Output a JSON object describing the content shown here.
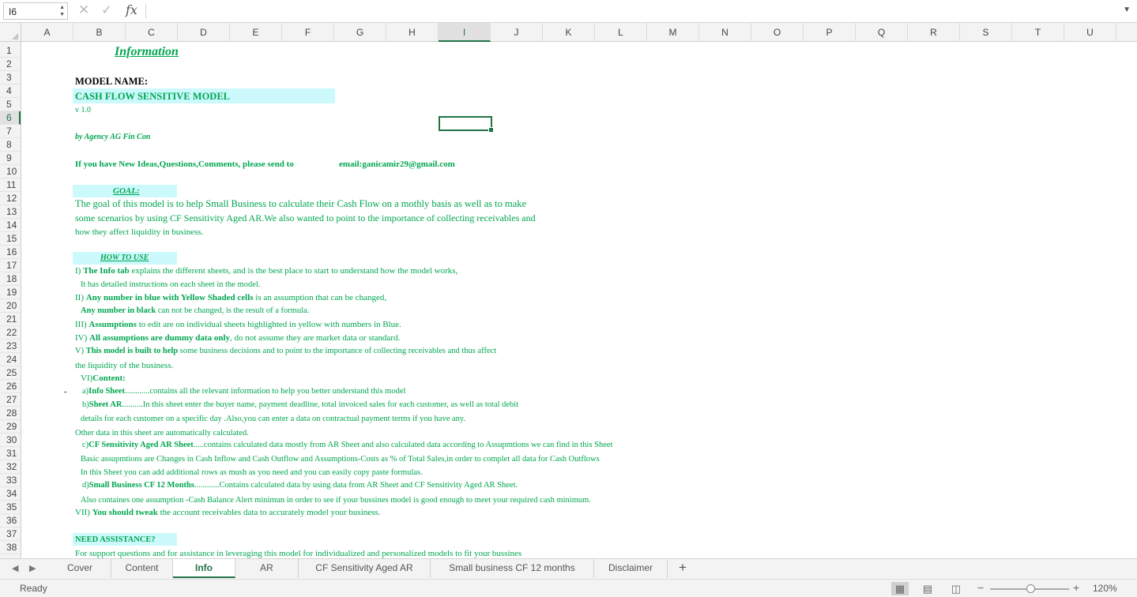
{
  "formula_bar": {
    "name_box": "I6",
    "cancel_icon": "✕",
    "enter_icon": "✓",
    "fx_label": "fx",
    "formula": ""
  },
  "columns": [
    "A",
    "B",
    "C",
    "D",
    "E",
    "F",
    "G",
    "H",
    "I",
    "J",
    "K",
    "L",
    "M",
    "N",
    "O",
    "P",
    "Q",
    "R",
    "S",
    "T",
    "U"
  ],
  "selected_column": "I",
  "rows": [
    "1",
    "2",
    "3",
    "4",
    "5",
    "6",
    "7",
    "8",
    "9",
    "10",
    "11",
    "12",
    "13",
    "14",
    "15",
    "16",
    "17",
    "18",
    "19",
    "20",
    "21",
    "22",
    "23",
    "24",
    "25",
    "26",
    "27",
    "28",
    "29",
    "30",
    "31",
    "32",
    "33",
    "34",
    "35",
    "36",
    "37",
    "38"
  ],
  "selected_row": "6",
  "sheet": {
    "title": "Information",
    "model_name_label": "MODEL NAME:",
    "model_name": "CASH FLOW SENSITIVE MODEL",
    "version": "v 1.0",
    "author": "by Agency AG Fin Con",
    "contact_text": "If you have New Ideas,Questions,Comments, please send to",
    "contact_email": "email:ganicamir29@gmail.com",
    "goal_label": "GOAL:",
    "goal_lines": [
      "The goal of this model is to help Small Business to calculate their Cash Flow on a mothly basis as well as to make",
      "some scenarios by using CF Sensitivity Aged AR.We also wanted to point to the importance of collecting receivables and",
      "how they affect liquidity in business."
    ],
    "how_to_label": "HOW TO USE",
    "l17_a": "I) ",
    "l17_b": "The Info tab",
    "l17_c": " explains the different sheets, and is the best place to start to understand how the model works,",
    "l18": "It has detailed instructions on each sheet in the model.",
    "l19_a": "II) ",
    "l19_b": "Any number in blue with Yellow Shaded cells",
    "l19_c": " is an assumption that can be changed,",
    "l20_b": "Any number in black",
    "l20_c": "  can not be changed,  is the result of a formula.",
    "l21_a": "III) ",
    "l21_b": "Assumptions",
    "l21_c": "  to edit are on individual sheets highlighted in yellow with numbers in Blue.",
    "l22_a": "IV) ",
    "l22_b": "All assumptions are dummy data only",
    "l22_c": ", do not assume they are market data or standard.",
    "l23_a": "V) ",
    "l23_b": "This model is built to help",
    "l23_c": " some business decisions and to point to the importance of collecting receivables and thus affect",
    "l24": "the liquidity of the business.",
    "l25_a": "VI)",
    "l25_b": "Content:",
    "l26_dash": "-",
    "l26_a": "a)",
    "l26_b": "Info Sheet",
    "l26_c": "............contains all the relevant information to help you better understand this model",
    "l27_a": "b)",
    "l27_b": "Sheet AR",
    "l27_c": "..........In this sheet enter the buyer name, payment deadline, total invoiced sales for each customer, as well as total debit",
    "l28": "details for each customer on a specific day .Also,you can enter a data on contractual payment terms if you have any.",
    "l29": "Other data in this sheet are automatically calculated.",
    "l30_a": "c)",
    "l30_b": "CF Sensitivity Aged AR Sheet",
    "l30_c": ".....contains calculated data mostly from AR Sheet and also calculated data according to Assupmtions we can find in this Sheet",
    "l31": "Basic assupmtions are Changes in Cash Inflow and Cash Outflow and Assumptions-Costs as % of Total Sales,in order to complet all data for Cash Outflows",
    "l32": "In this Sheet you can add additional rows as mush as you need and you can easily copy paste formulas.",
    "l33_a": "d)",
    "l33_b": "Small Business CF 12 Months",
    "l33_c": "............Contains calculated data by using data from AR Sheet and CF Sensitivity Aged AR Sheet.",
    "l34": "Also containes one assumption -Cash Balance Alert minimun in order to see if your bussines model is good enough to meet your required cash minimum.",
    "l35_a": "VII) ",
    "l35_b": "You should tweak",
    "l35_c": " the account receivables data to accurately model your business.",
    "assist_label": "NEED ASSISTANCE?",
    "l38": "For support questions and for assistance in leveraging this model for individualized and personalized models to fit your bussines"
  },
  "tabs": {
    "prev_icon": "◀",
    "next_icon": "▶",
    "items": [
      "Cover",
      "Content",
      "Info",
      "AR",
      "CF Sensitivity Aged AR",
      "Small business CF 12 months",
      "Disclaimer"
    ],
    "active": "Info",
    "add_icon": "+"
  },
  "status": {
    "ready": "Ready",
    "zoom": "120%",
    "zoom_out": "−",
    "zoom_in": "+"
  },
  "colors": {
    "text_green": "#00a650",
    "fill_cyan": "#ccfafc",
    "excel_green": "#217346"
  }
}
